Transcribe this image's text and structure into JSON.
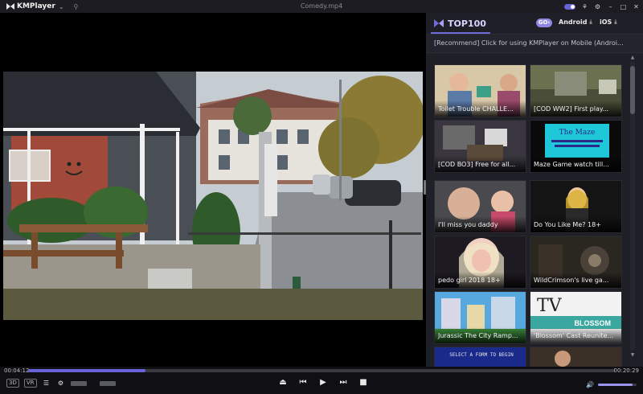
{
  "app": {
    "brand": "KMPlayer",
    "window_title": "Comedy.mp4",
    "accent": "#6a62d8"
  },
  "panel": {
    "title": "TOP100",
    "go_badge": "GO",
    "android_label": "Android",
    "ios_label": "iOS",
    "recommend": "[Recommend] Click for using KMPlayer on Mobile (Androi..."
  },
  "videos": [
    {
      "title": "Toilet Trouble CHALLE..."
    },
    {
      "title": "[COD WW2] First play..."
    },
    {
      "title": "[COD BO3] Free for all..."
    },
    {
      "title": "Maze Game watch till..."
    },
    {
      "title": "I'll miss you daddy"
    },
    {
      "title": "Do You Like Me? 18+"
    },
    {
      "title": "pedo girl 2018 18+"
    },
    {
      "title": "WildCrimson's live ga..."
    },
    {
      "title": "Jurassic The City Ramp..."
    },
    {
      "title": "'Blossom' Cast Reunite..."
    }
  ],
  "thumb_text": {
    "maze_line1": "The Maze",
    "blossom": "BLOSSOM",
    "tv": "TV",
    "select_text": "SELECT A FORM TO BEGIN"
  },
  "playback": {
    "current_time": "00:04:12",
    "total_time": "00:20:29",
    "progress": 0.2,
    "volume": 0.9
  },
  "controls": {
    "mode_3d": "3D",
    "mode_vr": "VR"
  }
}
